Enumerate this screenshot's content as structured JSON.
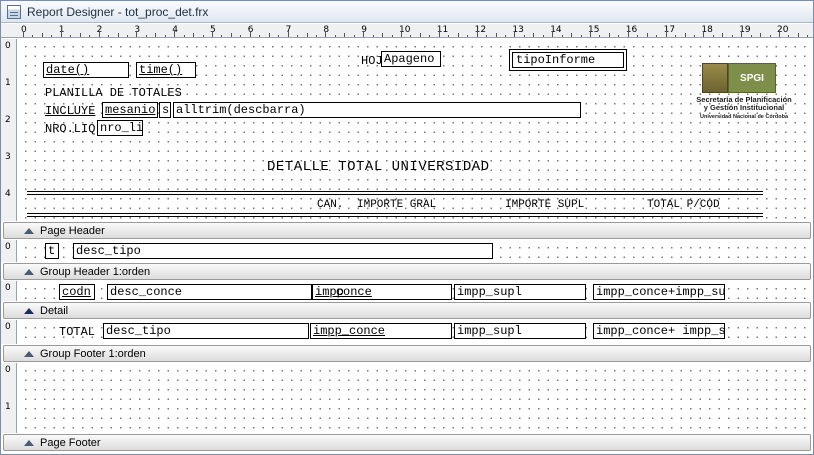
{
  "window": {
    "title": "Report Designer - tot_proc_det.frx",
    "icon": "report-designer-icon"
  },
  "ruler": {
    "h_labels": [
      "0",
      "1",
      "2",
      "3",
      "4",
      "5",
      "6",
      "7",
      "8",
      "9",
      "10",
      "11",
      "12",
      "13",
      "14",
      "15",
      "16",
      "17",
      "18",
      "19",
      "20"
    ],
    "v_page_header": [
      "0",
      "1",
      "2",
      "3",
      "4"
    ],
    "v_zero": "0",
    "v_footer": [
      "0",
      "1"
    ]
  },
  "bands": {
    "page_header": "Page Header",
    "group_header": "Group Header 1:orden",
    "detail": "Detail",
    "group_footer": "Group Footer 1:orden",
    "page_footer": "Page Footer"
  },
  "page_header": {
    "hoja_label": "HOJ",
    "hoja_field": "Apageno",
    "tipo_informe": "tipoInforme",
    "date_field": "date()",
    "time_field": "time()",
    "planilla": "PLANILLA DE TOTALES",
    "incluye_label": "INCLUYE",
    "mesanio_field": "mesanio",
    "small_field": "s",
    "alltrim_field": "alltrim(descbarra)",
    "nro_liq_label": "NRO.LIQ",
    "nro_liq_field": "nro_li",
    "logo_box": "SPGI",
    "logo_line1": "Secretaría de Planificación",
    "logo_line2": "y Gestión Institucional",
    "logo_line3": "Universidad Nacional de Córdoba",
    "report_title": "DETALLE TOTAL UNIVERSIDAD",
    "col_can": "CAN.",
    "col_importe_gral": "IMPORTE GRAL",
    "col_importe_supl": "IMPORTE SUPL",
    "col_total": "TOTAL P/COD"
  },
  "group_header": {
    "t_field": "t",
    "desc_tipo": "desc_tipo"
  },
  "detail": {
    "codn": "codn",
    "desc_conce": "desc_conce",
    "impp_conce_a": "impp",
    "impp_conce_b": "conce",
    "impp_supl": "impp_supl",
    "impp_total": "impp_conce+impp_sup"
  },
  "group_footer": {
    "total_label": "TOTAL",
    "desc_tipo": "desc_tipo",
    "impp_conce": "impp_conce",
    "impp_supl": "impp_supl",
    "impp_total": "impp_conce+ impp_su"
  }
}
